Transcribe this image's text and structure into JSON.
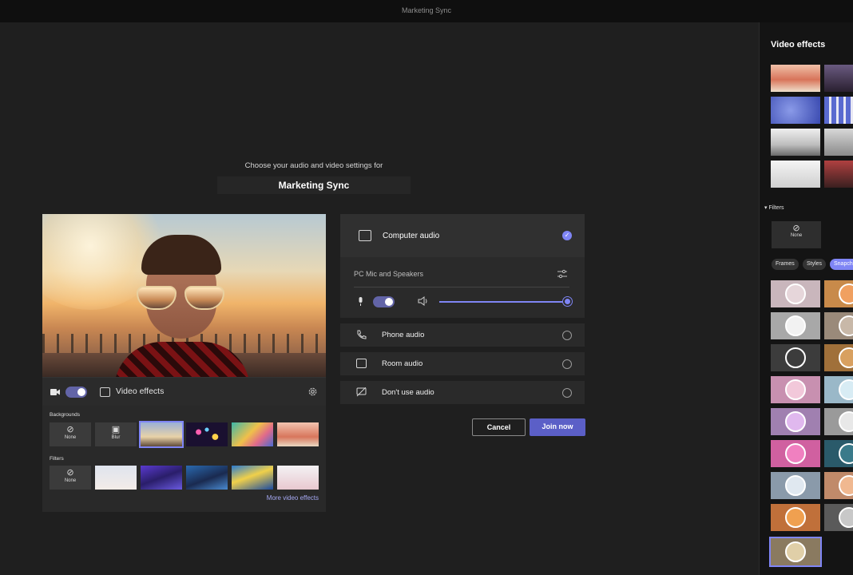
{
  "window": {
    "title": "Marketing Sync"
  },
  "prejoin": {
    "prompt": "Choose your audio and video settings for",
    "meeting_name": "Marketing Sync"
  },
  "video": {
    "camera_on": true,
    "effects_label": "Video effects",
    "backgrounds_label": "Backgrounds",
    "filters_label": "Filters",
    "none_label": "None",
    "blur_label": "Blur",
    "more_link": "More video effects"
  },
  "audio": {
    "computer_audio_label": "Computer audio",
    "device_label": "PC Mic and Speakers",
    "mic_on": true,
    "volume": 1.0,
    "options": [
      {
        "label": "Phone audio",
        "icon": "phone-icon"
      },
      {
        "label": "Room audio",
        "icon": "room-icon"
      },
      {
        "label": "Don't use audio",
        "icon": "no-audio-icon"
      }
    ]
  },
  "actions": {
    "cancel": "Cancel",
    "join": "Join now"
  },
  "effects_panel": {
    "title": "Video effects",
    "filters_heading": "Filters",
    "none_label": "None",
    "tabs": [
      {
        "label": "Frames",
        "active": false
      },
      {
        "label": "Styles",
        "active": false
      },
      {
        "label": "Snapchat",
        "active": true
      }
    ]
  },
  "colors": {
    "accent": "#7f85f5",
    "join_button": "#5b5fc7",
    "background": "#1f1f1f",
    "panel": "#141414"
  }
}
